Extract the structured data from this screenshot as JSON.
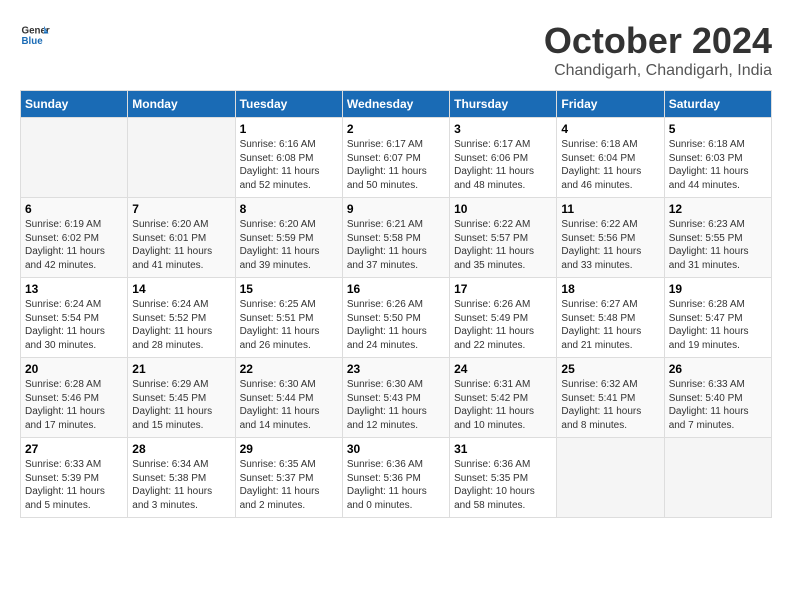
{
  "logo": {
    "general": "General",
    "blue": "Blue"
  },
  "title": "October 2024",
  "subtitle": "Chandigarh, Chandigarh, India",
  "weekdays": [
    "Sunday",
    "Monday",
    "Tuesday",
    "Wednesday",
    "Thursday",
    "Friday",
    "Saturday"
  ],
  "weeks": [
    [
      {
        "day": "",
        "info": ""
      },
      {
        "day": "",
        "info": ""
      },
      {
        "day": "1",
        "info": "Sunrise: 6:16 AM\nSunset: 6:08 PM\nDaylight: 11 hours\nand 52 minutes."
      },
      {
        "day": "2",
        "info": "Sunrise: 6:17 AM\nSunset: 6:07 PM\nDaylight: 11 hours\nand 50 minutes."
      },
      {
        "day": "3",
        "info": "Sunrise: 6:17 AM\nSunset: 6:06 PM\nDaylight: 11 hours\nand 48 minutes."
      },
      {
        "day": "4",
        "info": "Sunrise: 6:18 AM\nSunset: 6:04 PM\nDaylight: 11 hours\nand 46 minutes."
      },
      {
        "day": "5",
        "info": "Sunrise: 6:18 AM\nSunset: 6:03 PM\nDaylight: 11 hours\nand 44 minutes."
      }
    ],
    [
      {
        "day": "6",
        "info": "Sunrise: 6:19 AM\nSunset: 6:02 PM\nDaylight: 11 hours\nand 42 minutes."
      },
      {
        "day": "7",
        "info": "Sunrise: 6:20 AM\nSunset: 6:01 PM\nDaylight: 11 hours\nand 41 minutes."
      },
      {
        "day": "8",
        "info": "Sunrise: 6:20 AM\nSunset: 5:59 PM\nDaylight: 11 hours\nand 39 minutes."
      },
      {
        "day": "9",
        "info": "Sunrise: 6:21 AM\nSunset: 5:58 PM\nDaylight: 11 hours\nand 37 minutes."
      },
      {
        "day": "10",
        "info": "Sunrise: 6:22 AM\nSunset: 5:57 PM\nDaylight: 11 hours\nand 35 minutes."
      },
      {
        "day": "11",
        "info": "Sunrise: 6:22 AM\nSunset: 5:56 PM\nDaylight: 11 hours\nand 33 minutes."
      },
      {
        "day": "12",
        "info": "Sunrise: 6:23 AM\nSunset: 5:55 PM\nDaylight: 11 hours\nand 31 minutes."
      }
    ],
    [
      {
        "day": "13",
        "info": "Sunrise: 6:24 AM\nSunset: 5:54 PM\nDaylight: 11 hours\nand 30 minutes."
      },
      {
        "day": "14",
        "info": "Sunrise: 6:24 AM\nSunset: 5:52 PM\nDaylight: 11 hours\nand 28 minutes."
      },
      {
        "day": "15",
        "info": "Sunrise: 6:25 AM\nSunset: 5:51 PM\nDaylight: 11 hours\nand 26 minutes."
      },
      {
        "day": "16",
        "info": "Sunrise: 6:26 AM\nSunset: 5:50 PM\nDaylight: 11 hours\nand 24 minutes."
      },
      {
        "day": "17",
        "info": "Sunrise: 6:26 AM\nSunset: 5:49 PM\nDaylight: 11 hours\nand 22 minutes."
      },
      {
        "day": "18",
        "info": "Sunrise: 6:27 AM\nSunset: 5:48 PM\nDaylight: 11 hours\nand 21 minutes."
      },
      {
        "day": "19",
        "info": "Sunrise: 6:28 AM\nSunset: 5:47 PM\nDaylight: 11 hours\nand 19 minutes."
      }
    ],
    [
      {
        "day": "20",
        "info": "Sunrise: 6:28 AM\nSunset: 5:46 PM\nDaylight: 11 hours\nand 17 minutes."
      },
      {
        "day": "21",
        "info": "Sunrise: 6:29 AM\nSunset: 5:45 PM\nDaylight: 11 hours\nand 15 minutes."
      },
      {
        "day": "22",
        "info": "Sunrise: 6:30 AM\nSunset: 5:44 PM\nDaylight: 11 hours\nand 14 minutes."
      },
      {
        "day": "23",
        "info": "Sunrise: 6:30 AM\nSunset: 5:43 PM\nDaylight: 11 hours\nand 12 minutes."
      },
      {
        "day": "24",
        "info": "Sunrise: 6:31 AM\nSunset: 5:42 PM\nDaylight: 11 hours\nand 10 minutes."
      },
      {
        "day": "25",
        "info": "Sunrise: 6:32 AM\nSunset: 5:41 PM\nDaylight: 11 hours\nand 8 minutes."
      },
      {
        "day": "26",
        "info": "Sunrise: 6:33 AM\nSunset: 5:40 PM\nDaylight: 11 hours\nand 7 minutes."
      }
    ],
    [
      {
        "day": "27",
        "info": "Sunrise: 6:33 AM\nSunset: 5:39 PM\nDaylight: 11 hours\nand 5 minutes."
      },
      {
        "day": "28",
        "info": "Sunrise: 6:34 AM\nSunset: 5:38 PM\nDaylight: 11 hours\nand 3 minutes."
      },
      {
        "day": "29",
        "info": "Sunrise: 6:35 AM\nSunset: 5:37 PM\nDaylight: 11 hours\nand 2 minutes."
      },
      {
        "day": "30",
        "info": "Sunrise: 6:36 AM\nSunset: 5:36 PM\nDaylight: 11 hours\nand 0 minutes."
      },
      {
        "day": "31",
        "info": "Sunrise: 6:36 AM\nSunset: 5:35 PM\nDaylight: 10 hours\nand 58 minutes."
      },
      {
        "day": "",
        "info": ""
      },
      {
        "day": "",
        "info": ""
      }
    ]
  ]
}
